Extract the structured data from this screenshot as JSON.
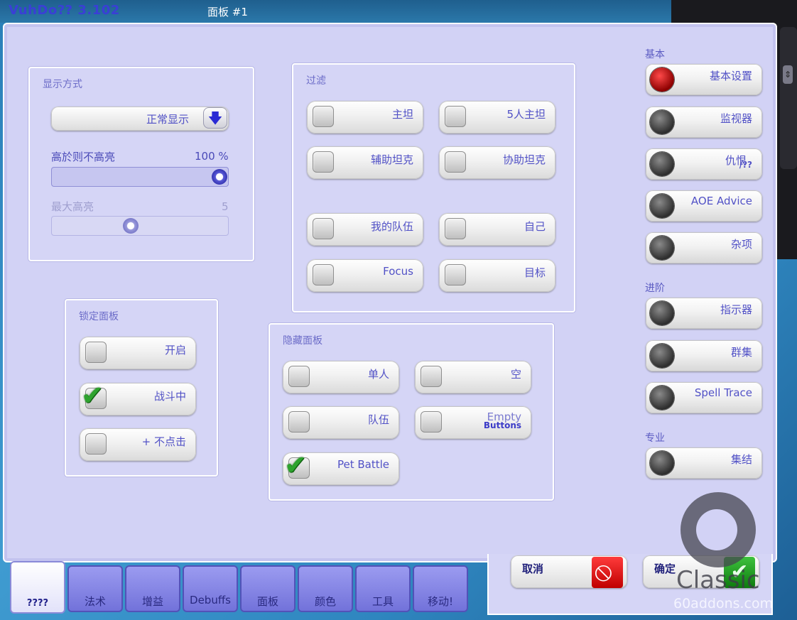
{
  "app": {
    "title": "VuhDo?? 3.102",
    "panel_title": "面板 #1"
  },
  "display": {
    "title": "显示方式",
    "mode_value": "正常显示",
    "highlight_label": "高於则不高亮",
    "highlight_value": "100 %",
    "highlight_level_percent": 100,
    "max_label": "最大高亮",
    "max_value": "5"
  },
  "filter": {
    "title": "过滤",
    "items": [
      {
        "label": "主坦",
        "checked": false
      },
      {
        "label": "5人主坦",
        "checked": false
      },
      {
        "label": "辅助坦克",
        "checked": false
      },
      {
        "label": "协助坦克",
        "checked": false
      },
      {
        "label": "我的队伍",
        "checked": false
      },
      {
        "label": "自己",
        "checked": false
      },
      {
        "label": "Focus",
        "checked": false
      },
      {
        "label": "目标",
        "checked": false
      }
    ]
  },
  "lock": {
    "title": "锁定面板",
    "items": [
      {
        "label": "开启",
        "checked": false
      },
      {
        "label": "战斗中",
        "checked": true
      },
      {
        "label": "+ 不点击",
        "checked": false
      }
    ]
  },
  "hide": {
    "title": "隐藏面板",
    "items": [
      {
        "label": "单人",
        "checked": false
      },
      {
        "label": "空",
        "checked": false
      },
      {
        "label": "队伍",
        "checked": false
      },
      {
        "label": "Empty",
        "sublabel": "Buttons",
        "checked": false
      },
      {
        "label": "Pet Battle",
        "checked": true
      }
    ]
  },
  "nav": {
    "basic_title": "基本",
    "basic_items": [
      {
        "label": "基本设置",
        "active": true
      },
      {
        "label": "监视器",
        "active": false
      },
      {
        "label": "仇恨",
        "sublabel": "/??",
        "active": false
      },
      {
        "label": "AOE Advice",
        "active": false
      },
      {
        "label": "杂项",
        "active": false
      }
    ],
    "advanced_title": "进阶",
    "advanced_items": [
      {
        "label": "指示器",
        "active": false
      },
      {
        "label": "群集",
        "active": false
      },
      {
        "label": "Spell Trace",
        "active": false
      }
    ],
    "expert_title": "专业",
    "expert_items": [
      {
        "label": "集结",
        "active": false
      }
    ]
  },
  "tabs": [
    {
      "label": "????",
      "active": true
    },
    {
      "label": "法术",
      "active": false
    },
    {
      "label": "增益",
      "active": false
    },
    {
      "label": "Debuffs",
      "active": false
    },
    {
      "label": "面板",
      "active": false
    },
    {
      "label": "颜色",
      "active": false
    },
    {
      "label": "工具",
      "active": false
    },
    {
      "label": "移动!",
      "active": false
    }
  ],
  "actions": {
    "cancel_label": "取消",
    "ok_label": "确定"
  },
  "watermark": {
    "brand": "Classic",
    "site": "60addons.com"
  }
}
